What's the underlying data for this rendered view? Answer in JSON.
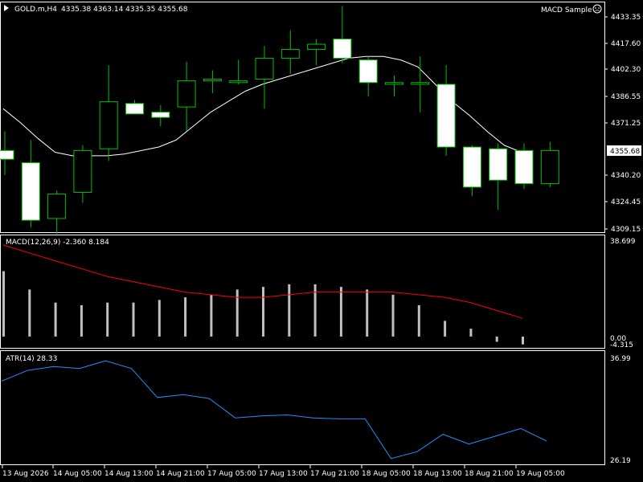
{
  "header": {
    "symbol": "GOLD.m,H4",
    "ohlc": "4335.38 4363.14 4335.35 4355.68",
    "expert": "MACD Sample",
    "expert_icon": "smiley-face-icon"
  },
  "price_axis": {
    "ticks": [
      "4433.35",
      "4417.60",
      "4402.30",
      "4386.55",
      "4371.25",
      "4340.20",
      "4324.45",
      "4309.15"
    ],
    "current": "4355.68"
  },
  "macd": {
    "label": "MACD(12,26,9) -2.360 8.184",
    "ticks": [
      "38.699",
      "0.00",
      "-4.315"
    ]
  },
  "atr": {
    "label": "ATR(14) 28.33",
    "ticks": [
      "36.99",
      "26.19"
    ]
  },
  "time_axis": [
    "13 Aug 2026",
    "14 Aug 05:00",
    "14 Aug 13:00",
    "14 Aug 21:00",
    "17 Aug 05:00",
    "17 Aug 13:00",
    "17 Aug 21:00",
    "18 Aug 05:00",
    "18 Aug 13:00",
    "18 Aug 21:00",
    "19 Aug 05:00"
  ],
  "colors": {
    "background": "#000000",
    "bull_body": "#000000",
    "bear_body": "#ffffff",
    "candle_outline": "#00c000",
    "ma_line": "#ffffff",
    "macd_hist": "#c0c0c0",
    "macd_signal": "#ff0000",
    "atr_line": "#1e90ff",
    "grid": "#ffffff"
  },
  "chart_data": [
    {
      "type": "candlestick",
      "title": "GOLD.m,H4",
      "ylim": [
        4309.15,
        4441
      ],
      "candles": [
        {
          "o": 4356,
          "h": 4367,
          "l": 4342,
          "c": 4351
        },
        {
          "o": 4349,
          "h": 4362,
          "l": 4312,
          "c": 4316
        },
        {
          "o": 4317,
          "h": 4333,
          "l": 4308,
          "c": 4331
        },
        {
          "o": 4332,
          "h": 4359,
          "l": 4326,
          "c": 4356
        },
        {
          "o": 4357,
          "h": 4405,
          "l": 4350,
          "c": 4384
        },
        {
          "o": 4383,
          "h": 4385,
          "l": 4377,
          "c": 4377
        },
        {
          "o": 4378,
          "h": 4382,
          "l": 4370,
          "c": 4375
        },
        {
          "o": 4381,
          "h": 4407,
          "l": 4367,
          "c": 4396
        },
        {
          "o": 4396,
          "h": 4402,
          "l": 4389,
          "c": 4397
        },
        {
          "o": 4395,
          "h": 4408,
          "l": 4394,
          "c": 4396
        },
        {
          "o": 4397,
          "h": 4416,
          "l": 4380,
          "c": 4409
        },
        {
          "o": 4409,
          "h": 4425,
          "l": 4400,
          "c": 4414
        },
        {
          "o": 4414,
          "h": 4420,
          "l": 4405,
          "c": 4417
        },
        {
          "o": 4420,
          "h": 4439,
          "l": 4406,
          "c": 4409
        },
        {
          "o": 4408,
          "h": 4410,
          "l": 4387,
          "c": 4395
        },
        {
          "o": 4394,
          "h": 4399,
          "l": 4387,
          "c": 4395
        },
        {
          "o": 4394,
          "h": 4410,
          "l": 4378,
          "c": 4395
        },
        {
          "o": 4394,
          "h": 4405,
          "l": 4353,
          "c": 4358
        },
        {
          "o": 4358,
          "h": 4359,
          "l": 4330,
          "c": 4335
        },
        {
          "o": 4357,
          "h": 4360,
          "l": 4322,
          "c": 4339
        },
        {
          "o": 4356,
          "h": 4360,
          "l": 4334,
          "c": 4337
        },
        {
          "o": 4337,
          "h": 4361,
          "l": 4335,
          "c": 4356
        }
      ],
      "ma": [
        4380,
        4372,
        4363,
        4355,
        4353,
        4353,
        4353,
        4354,
        4356,
        4358,
        4362,
        4370,
        4378,
        4384,
        4390,
        4394,
        4397,
        4400,
        4403,
        4406,
        4409,
        4410,
        4410,
        4408,
        4404,
        4394,
        4384,
        4376,
        4367,
        4359,
        4355
      ]
    },
    {
      "type": "bar",
      "title": "MACD(12,26,9) -2.360 8.184",
      "ylim": [
        -4.315,
        38.699
      ],
      "histogram": [
        25,
        18,
        13,
        12,
        13,
        13,
        14,
        15,
        16,
        18,
        19,
        20,
        20,
        19,
        18,
        16,
        12,
        6,
        3,
        -2,
        -3
      ],
      "signal": [
        35,
        32,
        29,
        26,
        23,
        21,
        19,
        17,
        16,
        15,
        15,
        16,
        17,
        17,
        17,
        17,
        16,
        15,
        13,
        10,
        7
      ]
    },
    {
      "type": "line",
      "title": "ATR(14) 28.33",
      "ylim": [
        26.19,
        36.99
      ],
      "values": [
        34.5,
        35.6,
        36.0,
        35.8,
        36.6,
        35.8,
        32.8,
        33.1,
        32.7,
        30.7,
        30.9,
        31.0,
        30.7,
        30.6,
        30.6,
        26.5,
        27.2,
        29.0,
        28.0,
        28.8,
        29.6,
        28.3
      ]
    }
  ]
}
